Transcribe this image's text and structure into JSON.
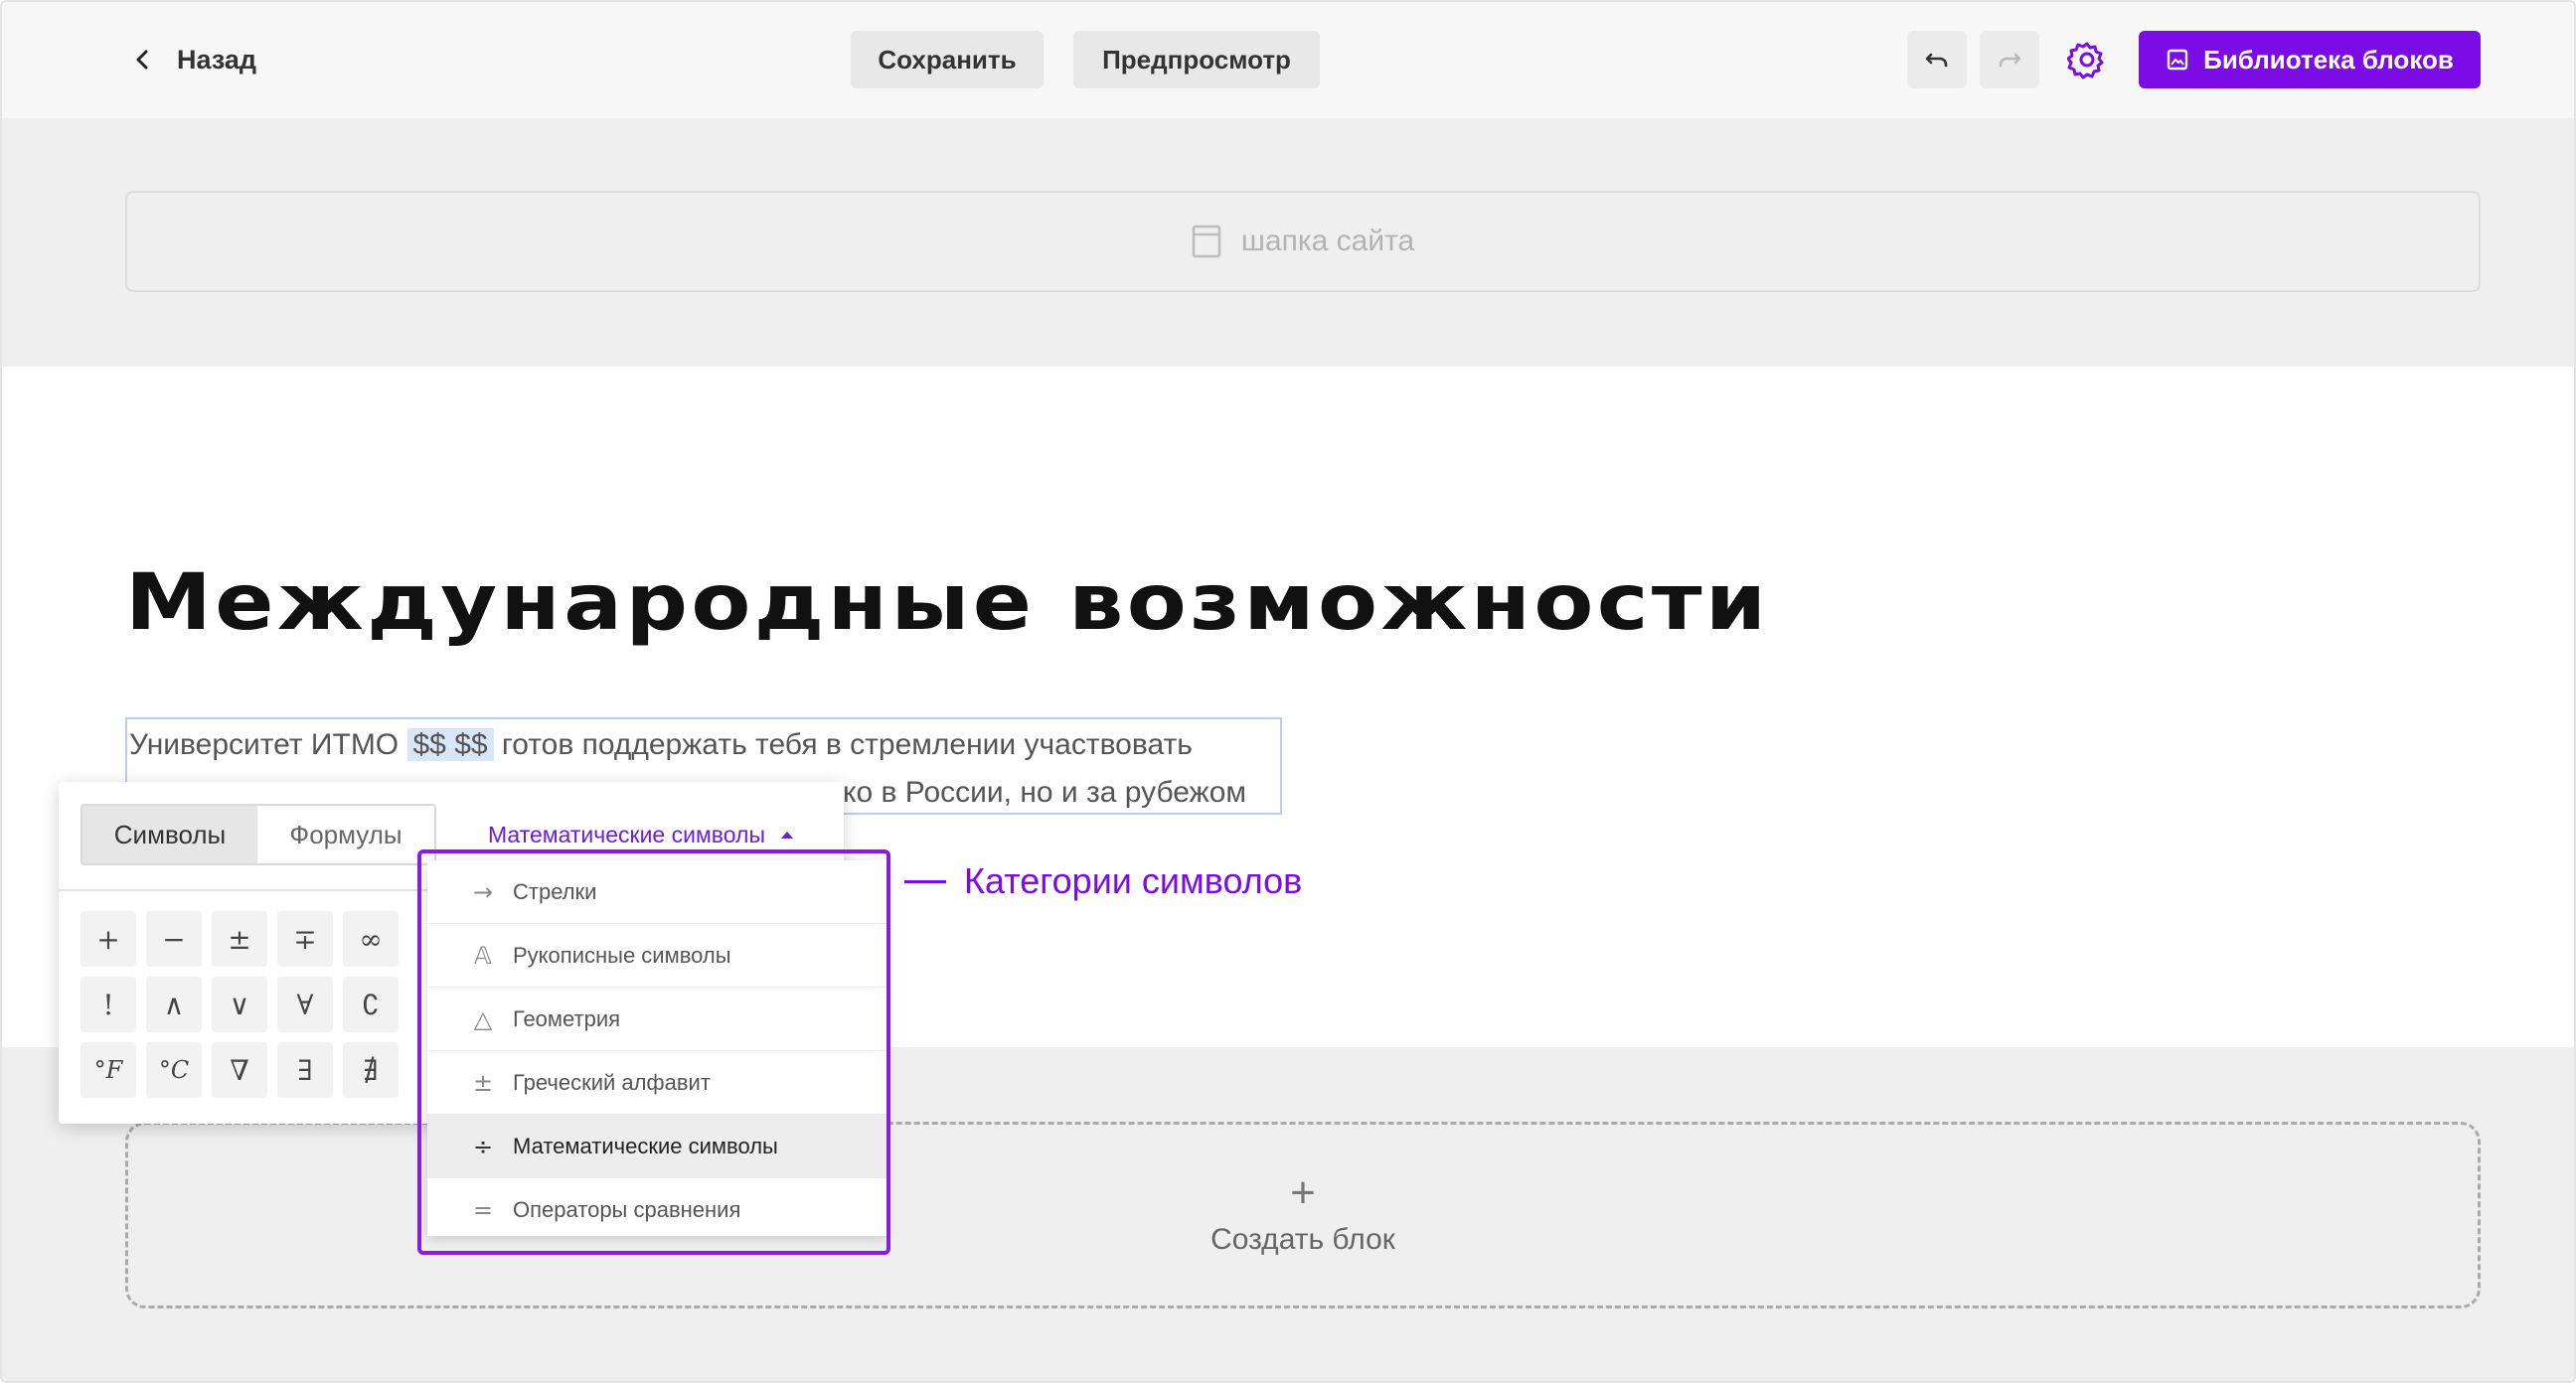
{
  "topbar": {
    "back_label": "Назад",
    "save_label": "Сохранить",
    "preview_label": "Предпросмотр",
    "library_label": "Библиотека блоков"
  },
  "icons": {
    "back": "chevron-left-icon",
    "undo": "undo-icon",
    "redo": "redo-icon",
    "settings": "gear-icon",
    "library": "image-icon",
    "header": "page-icon"
  },
  "colors": {
    "accent": "#7b0ce6",
    "selection": "#b6cff5",
    "formula_chip": "#d8e6f7"
  },
  "header_placeholder": "шапка сайта",
  "content": {
    "title": "Международные возможности",
    "para_start": "Университет ИТМО",
    "formula_chip": "$$ $$",
    "para_rest": "готов поддержать тебя в стремлении участвовать",
    "para_line2_tail": "ко в России, но и за рубежом"
  },
  "create_block_label": "Создать блок",
  "symbol_panel": {
    "tabs": [
      {
        "label": "Символы",
        "active": true
      },
      {
        "label": "Формулы",
        "active": false
      }
    ],
    "category_selected": "Математические символы",
    "symbols": [
      "+",
      "−",
      "±",
      "∓",
      "∞",
      "!",
      "∧",
      "∨",
      "∀",
      "∁",
      "°F",
      "°C",
      "∇",
      "∃",
      "∄"
    ],
    "categories": [
      {
        "icon": "→",
        "label": "Стрелки",
        "selected": false
      },
      {
        "icon": "𝔸",
        "label": "Рукописные символы",
        "selected": false
      },
      {
        "icon": "△",
        "label": "Геометрия",
        "selected": false
      },
      {
        "icon": "±",
        "label": "Греческий алфавит",
        "selected": false
      },
      {
        "icon": "÷",
        "label": "Математические символы",
        "selected": true
      },
      {
        "icon": "=",
        "label": "Операторы сравнения",
        "selected": false
      }
    ]
  },
  "annotation": "Категории символов"
}
